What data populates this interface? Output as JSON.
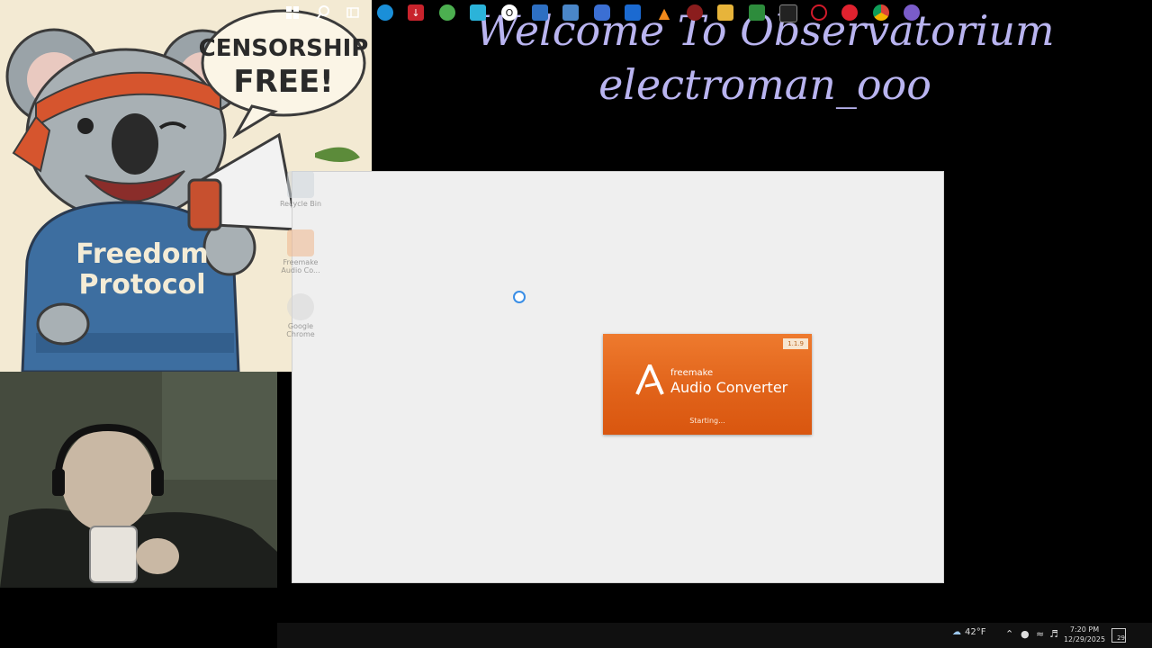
{
  "overlay": {
    "speech_bubble_line1": "CENSORSHIP",
    "speech_bubble_line2": "FREE!",
    "hoodie_line1": "Freedom",
    "hoodie_line2": "Protocol",
    "welcome_line1": "Welcome To Observatorium",
    "welcome_line2": "electroman_ooo"
  },
  "desktop": {
    "icons": [
      {
        "label": "Recycle Bin",
        "icon": "recycle-bin-icon"
      },
      {
        "label": "Freemake Audio Co...",
        "icon": "freemake-icon"
      },
      {
        "label": "Google Chrome",
        "icon": "chrome-icon"
      }
    ]
  },
  "splash": {
    "version": "1.1.9",
    "brand": "freemake",
    "product": "Audio Converter",
    "status": "Starting..."
  },
  "taskbar": {
    "temperature": "42°F",
    "time": "7:20 PM",
    "date": "12/29/2025",
    "notification_count": "29",
    "icons": [
      "windows-start-icon",
      "search-icon",
      "task-view-icon",
      "edge-icon",
      "downloader-icon",
      "torrent-icon",
      "box-icon",
      "opera-icon",
      "store-icon",
      "photos-icon",
      "camera-icon",
      "mail-icon",
      "vlc-icon",
      "media-icon",
      "file-explorer-icon",
      "excel-icon",
      "terminal-icon",
      "opera-gx-icon",
      "opera-red-icon",
      "chrome-icon",
      "chrome-profile-icon"
    ]
  },
  "colors": {
    "welcome_text": "#b9b4f0",
    "splash_orange": "#e1631a",
    "desktop_bg": "#efefef"
  }
}
